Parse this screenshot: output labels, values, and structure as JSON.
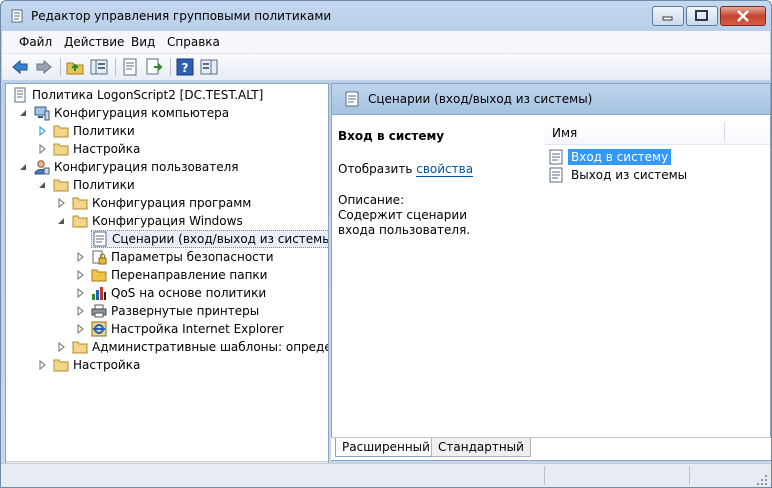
{
  "window": {
    "title": "Редактор управления групповыми политиками"
  },
  "menu": [
    "Файл",
    "Действие",
    "Вид",
    "Справка"
  ],
  "tree": {
    "root": "Политика LogonScript2 [DC.TEST.ALT]",
    "computer_config": "Конфигурация компьютера",
    "policies": "Политики",
    "preferences": "Настройка",
    "user_config": "Конфигурация пользователя",
    "software_settings": "Конфигурация программ",
    "windows_settings": "Конфигурация Windows",
    "scripts": "Сценарии (вход/выход из системы)",
    "security_settings": "Параметры безопасности",
    "folder_redirection": "Перенаправление папки",
    "qos": "QoS на основе политики",
    "deployed_printers": "Развернутые принтеры",
    "ie_maintenance": "Настройка Internet Explorer",
    "admin_templates": "Административные шаблоны: определения политик (ADMX-файлы)"
  },
  "right_pane": {
    "header": "Сценарии (вход/выход из системы)",
    "selected_title": "Вход в систему",
    "show_prefix": "Отобразить ",
    "show_link": "свойства",
    "description_label": "Описание:",
    "description_text": "Содержит сценарии входа пользователя.",
    "column_name": "Имя",
    "items": [
      "Вход в систему",
      "Выход из системы"
    ]
  },
  "tabs": {
    "extended": "Расширенный",
    "standard": "Стандартный"
  },
  "colors": {
    "selection": "#3399ff",
    "link": "#0054a6",
    "title_bar": "#b9cfe9"
  }
}
